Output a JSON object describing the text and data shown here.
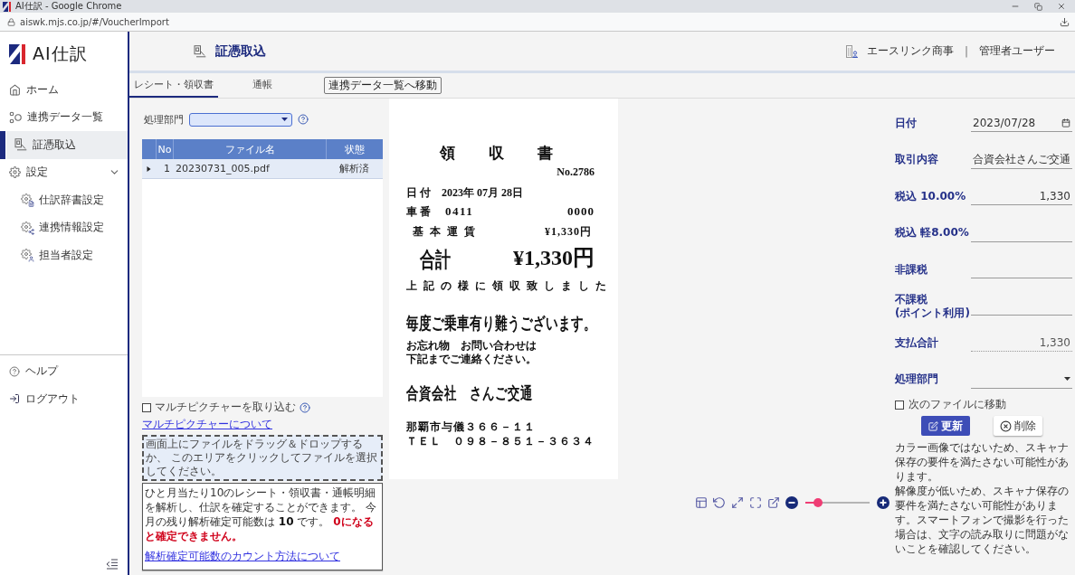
{
  "browser": {
    "title": "AI仕訳 - Google Chrome",
    "url": "aiswk.mjs.co.jp/#/VoucherImport"
  },
  "sidebar": {
    "logo": "AI仕訳",
    "items": [
      {
        "label": "ホーム",
        "selected": false
      },
      {
        "label": "連携データ一覧",
        "selected": false
      },
      {
        "label": "証憑取込",
        "selected": true
      },
      {
        "label": "設定",
        "selected": false,
        "expanded": true,
        "children": [
          {
            "label": "仕訳辞書設定",
            "selected": false
          },
          {
            "label": "連携情報設定",
            "selected": false
          },
          {
            "label": "担当者設定",
            "selected": false
          }
        ]
      }
    ],
    "footer_items": [
      {
        "label": "ヘルプ"
      },
      {
        "label": "ログアウト"
      }
    ]
  },
  "header": {
    "title": "証憑取込",
    "company": "エースリンク商事",
    "separator": "|",
    "user": "管理者ユーザー"
  },
  "tabs": [
    {
      "label": "レシート・領収書",
      "selected": true
    },
    {
      "label": "通帳",
      "selected": false
    }
  ],
  "tab_action": {
    "label": "連携データ一覧へ移動"
  },
  "left_panel": {
    "department": {
      "label": "処理部門"
    },
    "file_table": {
      "columns": [
        "No",
        "ファイル名",
        "状態"
      ],
      "rows": [
        {
          "no": "1",
          "file_name": "20230731_005.pdf",
          "status": "解析済",
          "selected": true,
          "expanded": false
        }
      ]
    },
    "multi_picture": {
      "label": "マルチピクチャーを取り込む",
      "checked": false,
      "link": "マルチピクチャーについて"
    },
    "dropzone": {
      "text": "画面上にファイルをドラッグ＆ドロップするか、 このエリアをクリックしてファイルを選択してください。"
    },
    "quota_note": {
      "text": "ひと月当たり10のレシート・領収書・通帳明細を解析し、仕訳を確定することができます。 今月の残り解析確定可能数は **10** です。 ",
      "warning": "0になると確定できません。",
      "link": "解析確定可能数のカウント方法について"
    }
  },
  "receipt": {
    "title": "領　収　書",
    "number": "No.2786",
    "date": {
      "label": "日 付",
      "value": "2023年 07月 28日"
    },
    "car": {
      "label": "車 番",
      "value": "0411",
      "code": "0000"
    },
    "fare": {
      "label": "基 本 運 賃",
      "value": "¥1,330円"
    },
    "total": {
      "label": "合計",
      "value": "¥1,330円"
    },
    "message": "上 記 の 様 に 領 収 致 し ま し た",
    "thanks": "毎度ご乗車有り難うございます。",
    "notes": [
      "お忘れ物　お問い合わせは",
      "下記までご連絡ください。"
    ],
    "company": "合資会社　さんご交通",
    "address": "那覇市与儀３６６－１１",
    "tel": "ＴＥＬ　０９８－８５１－３６３４"
  },
  "viewer": {
    "zoom": {
      "level": 0.2
    }
  },
  "form": {
    "fields": [
      {
        "label": "日付",
        "value": "2023/07/28",
        "kind": "date",
        "disabled": false
      },
      {
        "label": "取引内容",
        "value": "合資会社さんご交通",
        "kind": "text",
        "disabled": false
      },
      {
        "label": "税込 10.00%",
        "value": "1,330",
        "kind": "amount",
        "disabled": false
      },
      {
        "label": "税込 軽8.00%",
        "kind": "amount",
        "disabled": false
      },
      {
        "label": "非課税",
        "kind": "amount",
        "disabled": false
      },
      {
        "label": "不課税\n(ポイント利用)",
        "kind": "amount",
        "disabled": false
      },
      {
        "label": "支払合計",
        "value": "1,330",
        "kind": "amount",
        "disabled": true
      },
      {
        "label": "処理部門",
        "kind": "select",
        "disabled": false
      }
    ],
    "next_file": {
      "label": "次のファイルに移動",
      "checked": false
    },
    "buttons": [
      {
        "label": "更新",
        "kind": "primary"
      },
      {
        "label": "削除",
        "kind": "secondary"
      }
    ],
    "warnings": [
      "カラー画像ではないため、スキャナ保存の要件を満たさない可能性があります。",
      "解像度が低いため、スキャナ保存の要件を満たさない可能性があります。スマートフォンで撮影を行った場合は、文字の読み取りに問題がないことを確認してください。"
    ]
  }
}
